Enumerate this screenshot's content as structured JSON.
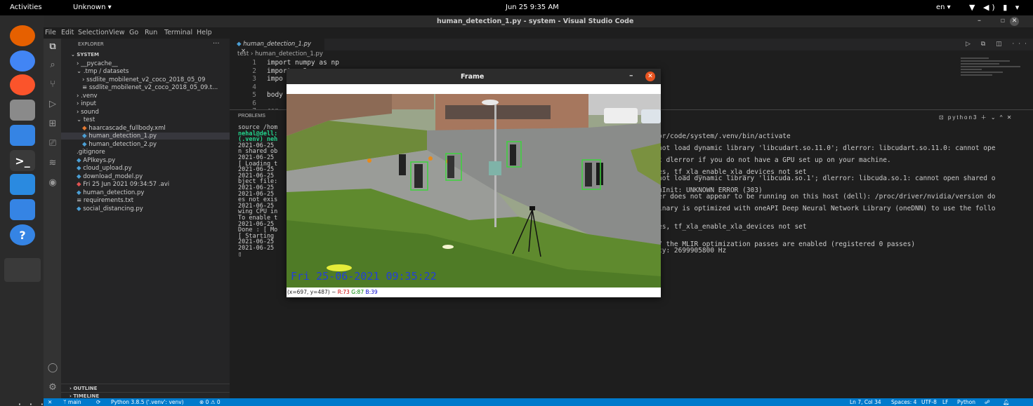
{
  "topbar": {
    "activities": "Activities",
    "app_menu": "Unknown ▾",
    "clock": "Jun 25  9:35 AM",
    "language": "en ▾",
    "tray": "▼ ◀) ▮ ▾"
  },
  "dock": {
    "apps": [
      {
        "name": "firefox-icon",
        "glyph": "",
        "color": "#e66000"
      },
      {
        "name": "chrome-icon",
        "glyph": "",
        "color": "#4285f4"
      },
      {
        "name": "brave-icon",
        "glyph": "",
        "color": "#fb542b"
      },
      {
        "name": "files-icon",
        "glyph": "",
        "color": "#8a8a8a"
      },
      {
        "name": "document-viewer-icon",
        "glyph": "",
        "color": "#3584e4"
      },
      {
        "name": "terminal-icon",
        "glyph": ">_",
        "color": "#3a3a3a"
      },
      {
        "name": "vscode-icon",
        "glyph": "",
        "color": "#2a8ae0"
      },
      {
        "name": "text-editor-icon",
        "glyph": "",
        "color": "#3584e4"
      },
      {
        "name": "help-icon",
        "glyph": "?",
        "color": "#3584e4"
      }
    ],
    "grid_glyph": "⋮⋮⋮"
  },
  "vscode": {
    "title": "human_detection_1.py - system - Visual Studio Code",
    "menu": [
      "File",
      "Edit",
      "Selection",
      "View",
      "Go",
      "Run",
      "Terminal",
      "Help"
    ],
    "explorer": {
      "header": "EXPLORER",
      "more": "···",
      "tree": [
        {
          "label": "⌄ SYSTEM",
          "indent": 0,
          "bold": true
        },
        {
          "label": "› __pycache__",
          "indent": 1
        },
        {
          "label": "⌄ .tmp / datasets",
          "indent": 1
        },
        {
          "label": "› ssdlite_mobilenet_v2_coco_2018_05_09",
          "indent": 2
        },
        {
          "label": "≡ ssdlite_mobilenet_v2_coco_2018_05_09.t...",
          "indent": 2
        },
        {
          "label": "› .venv",
          "indent": 1
        },
        {
          "label": "› input",
          "indent": 1
        },
        {
          "label": "› sound",
          "indent": 1
        },
        {
          "label": "⌄ test",
          "indent": 1
        },
        {
          "label": "haarcascade_fullbody.xml",
          "indent": 2,
          "color": "#e37933"
        },
        {
          "label": "human_detection_1.py",
          "indent": 2,
          "color": "#4b9fd5",
          "active": true
        },
        {
          "label": "human_detection_2.py",
          "indent": 2,
          "color": "#4b9fd5"
        },
        {
          "label": ".gitignore",
          "indent": 1
        },
        {
          "label": "APIkeys.py",
          "indent": 1,
          "color": "#4b9fd5"
        },
        {
          "label": "cloud_upload.py",
          "indent": 1,
          "color": "#4b9fd5"
        },
        {
          "label": "download_model.py",
          "indent": 1,
          "color": "#4b9fd5"
        },
        {
          "label": "Fri 25 Jun 2021 09:34:57 .avi",
          "indent": 1,
          "color": "#e05252"
        },
        {
          "label": "human_detection.py",
          "indent": 1,
          "color": "#4b9fd5"
        },
        {
          "label": "≡ requirements.txt",
          "indent": 1
        },
        {
          "label": "social_distancing.py",
          "indent": 1,
          "color": "#4b9fd5"
        }
      ],
      "outline": "› OUTLINE",
      "timeline": "› TIMELINE"
    },
    "tab": {
      "label": "human_detection_1.py",
      "close": "×"
    },
    "tab_actions": "▷ ⧉ ◫ ···",
    "breadcrumb": "test  ›  human_detection_1.py",
    "code": [
      {
        "n": "1",
        "text": "import numpy as np"
      },
      {
        "n": "2",
        "text": "import cv2"
      },
      {
        "n": "3",
        "text": "impo"
      },
      {
        "n": "4",
        "text": ""
      },
      {
        "n": "5",
        "text": "body"
      },
      {
        "n": "6",
        "text": ""
      },
      {
        "n": "7",
        "text": "cap "
      }
    ],
    "panel": {
      "tabs": [
        "PROBLEMS"
      ],
      "right": "⊡ python3  ＋ ⌄  ^  ✕",
      "left_lines": [
        "source /hom",
        "nehal@dell:",
        "(.venv) neh",
        "2021-06-25 ",
        "n shared ob",
        "2021-06-25 ",
        "[ Loading t",
        "2021-06-25 ",
        "2021-06-25 ",
        "bject file:",
        "2021-06-25 ",
        "2021-06-25 ",
        "es not exis",
        "2021-06-25 ",
        "wing CPU in",
        "To enable t",
        "2021-06-25 ",
        "Done : [ Mo",
        "[ Starting ",
        "2021-06-25 ",
        "2021-06-25 ",
        "▯"
      ],
      "right_lines": [
        {
          "row": 1,
          "text": "or/code/system/.venv/bin/activate"
        },
        {
          "row": 3,
          "text": "not load dynamic library 'libcudart.so.11.0'; dlerror: libcudart.so.11.0: cannot ope"
        },
        {
          "row": 5,
          "text": "t dlerror if you do not have a GPU set up on your machine."
        },
        {
          "row": 7,
          "text": "es, tf_xla_enable_xla_devices not set"
        },
        {
          "row": 8,
          "text": "not load dynamic library 'libcuda.so.1'; dlerror: libcuda.so.1: cannot open shared o"
        },
        {
          "row": 10,
          "text": "uInit: UNKNOWN ERROR (303)"
        },
        {
          "row": 11,
          "text": "er does not appear to be running on this host (dell): /proc/driver/nvidia/version do"
        },
        {
          "row": 13,
          "text": "inary is optimized with oneAPI Deep Neural Network Library (oneDNN) to use the follo"
        },
        {
          "row": 16,
          "text": "es, tf_xla_enable_xla_devices not set"
        },
        {
          "row": 19,
          "text": "7 the MLIR optimization passes are enabled (registered 0 passes)"
        },
        {
          "row": 20,
          "text": "cy: 2699905800 Hz"
        }
      ]
    },
    "status": {
      "remote": "✕",
      "branch": "ᛘ main",
      "sync": "⟳",
      "interpreter": "Python 3.8.5 ('.venv': venv)",
      "problems": "⊗ 0 ⚠ 0",
      "position": "Ln 7, Col 34",
      "spaces": "Spaces: 4",
      "encoding": "UTF-8",
      "eol": "LF",
      "language": "Python",
      "feedback": "☍",
      "bell": "🔔︎"
    }
  },
  "frame_window": {
    "title": "Frame",
    "minimize": "–",
    "close": "✕",
    "timestamp": "Fri 25-06-2021 09:35:22",
    "status_prefix": "(x=697, y=487) ~ ",
    "r": "R:73",
    "g": "G:87",
    "b": "B:39"
  },
  "colors": {
    "accent": "#007acc",
    "bbox": "#3cd33c",
    "timestamp": "#2340d6",
    "close_orange": "#e95420"
  }
}
